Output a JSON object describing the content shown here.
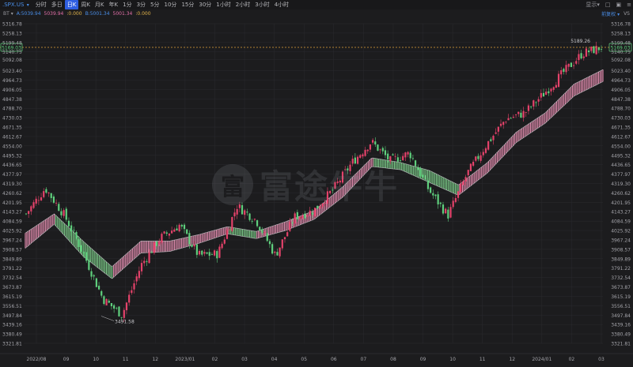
{
  "toolbar": {
    "symbol": ".SPX.US",
    "symbol_icon": "caret-down-icon",
    "tabs": [
      "分时",
      "多日",
      "日K",
      "周K",
      "月K",
      "年K",
      "1分",
      "3分",
      "5分",
      "10分",
      "15分",
      "30分",
      "1小时",
      "2小时",
      "3小时",
      "4小时"
    ],
    "active_tab": "日K",
    "display_label": "显示",
    "display_icon": "caret-down-icon",
    "icons": [
      "square-icon",
      "box-icon",
      "list-icon"
    ]
  },
  "indicators": {
    "name": "BT",
    "items": [
      {
        "text": "A:5039.94",
        "color": "#4a8ee8"
      },
      {
        "text": "5039.94",
        "color": "#e26fa8"
      },
      {
        "text": ":0.000",
        "color": "#e0b24a"
      },
      {
        "text": "B:5001.34",
        "color": "#4a8ee8"
      },
      {
        "text": "5001.34",
        "color": "#e26fa8"
      },
      {
        "text": ":0.000",
        "color": "#e0b24a"
      }
    ],
    "adjust_label": "前复权",
    "vs_label": "VS"
  },
  "colors": {
    "up": "#e4426a",
    "down": "#5fcf7d",
    "band_up": "#e78fb2",
    "band_down": "#7fd18c",
    "current_line": "#e0a23a",
    "grid": "#2b2b2f",
    "axis_text": "#a4a4aa"
  },
  "watermark": {
    "icon": "futu-logo-icon",
    "text": "富途牛牛"
  },
  "chart_data": {
    "type": "candlestick",
    "title": "",
    "y_ticks": [
      5316.78,
      5258.13,
      5199.48,
      5140.75,
      5092.08,
      5023.4,
      4964.73,
      4906.05,
      4847.38,
      4788.7,
      4730.03,
      4671.35,
      4612.67,
      4554.0,
      4495.32,
      4436.65,
      4377.97,
      4319.3,
      4260.62,
      4201.95,
      4143.27,
      4084.59,
      4025.92,
      3967.24,
      3908.57,
      3849.89,
      3791.22,
      3732.54,
      3673.87,
      3615.19,
      3556.51,
      3497.84,
      3439.16,
      3380.49,
      3321.81
    ],
    "x_labels": [
      "2022/08",
      "09",
      "10",
      "11",
      "12",
      "2023/01",
      "02",
      "03",
      "04",
      "05",
      "06",
      "07",
      "08",
      "09",
      "10",
      "11",
      "12",
      "2024/01",
      "02",
      "03"
    ],
    "ylim": [
      3321.81,
      5316.78
    ],
    "current_price": 5169.03,
    "current_price_label": "5169.03",
    "high_annotation": {
      "value": 5189.26,
      "label": "5189.26"
    },
    "low_annotation": {
      "value": 3491.58,
      "label": "3491.58"
    },
    "close_path": [
      {
        "x": "2022/08",
        "close": 4130
      },
      {
        "x": "2022/08 mid",
        "close": 4290
      },
      {
        "x": "09 start",
        "close": 4120
      },
      {
        "x": "09 mid",
        "close": 3880
      },
      {
        "x": "10 start",
        "close": 3600
      },
      {
        "x": "10 mid",
        "close": 3500
      },
      {
        "x": "11 start",
        "close": 3810
      },
      {
        "x": "11 mid",
        "close": 3980
      },
      {
        "x": "12 start",
        "close": 4060
      },
      {
        "x": "12 mid",
        "close": 3870
      },
      {
        "x": "2023/01 start",
        "close": 3880
      },
      {
        "x": "02 start",
        "close": 4180
      },
      {
        "x": "02 mid",
        "close": 4090
      },
      {
        "x": "03 mid",
        "close": 3870
      },
      {
        "x": "04 start",
        "close": 4110
      },
      {
        "x": "05 start",
        "close": 4150
      },
      {
        "x": "06 start",
        "close": 4280
      },
      {
        "x": "07 start",
        "close": 4450
      },
      {
        "x": "07 end",
        "close": 4580
      },
      {
        "x": "08 mid",
        "close": 4460
      },
      {
        "x": "09 start",
        "close": 4510
      },
      {
        "x": "10 start",
        "close": 4280
      },
      {
        "x": "10 end",
        "close": 4120
      },
      {
        "x": "11 start",
        "close": 4380
      },
      {
        "x": "11 end",
        "close": 4560
      },
      {
        "x": "12 mid",
        "close": 4720
      },
      {
        "x": "2024/01 start",
        "close": 4760
      },
      {
        "x": "2024/01 end",
        "close": 4880
      },
      {
        "x": "02 mid",
        "close": 5010
      },
      {
        "x": "03 start",
        "close": 5130
      },
      {
        "x": "03 end",
        "close": 5169
      }
    ],
    "band": [
      {
        "x": "2022/08",
        "upper": 4010,
        "lower": 3930
      },
      {
        "x": "09 start",
        "upper": 4130,
        "lower": 4080
      },
      {
        "x": "10 start",
        "upper": 3960,
        "lower": 3880
      },
      {
        "x": "11 start",
        "upper": 3800,
        "lower": 3740
      },
      {
        "x": "12 start",
        "upper": 3960,
        "lower": 3900
      },
      {
        "x": "2023/01 start",
        "upper": 3960,
        "lower": 3910
      },
      {
        "x": "02 start",
        "upper": 4000,
        "lower": 3960
      },
      {
        "x": "03 start",
        "upper": 4050,
        "lower": 4020
      },
      {
        "x": "04 start",
        "upper": 4020,
        "lower": 3990
      },
      {
        "x": "05 start",
        "upper": 4080,
        "lower": 4040
      },
      {
        "x": "06 start",
        "upper": 4150,
        "lower": 4110
      },
      {
        "x": "07 start",
        "upper": 4300,
        "lower": 4250
      },
      {
        "x": "08 start",
        "upper": 4480,
        "lower": 4440
      },
      {
        "x": "09 start",
        "upper": 4450,
        "lower": 4420
      },
      {
        "x": "10 start",
        "upper": 4400,
        "lower": 4340
      },
      {
        "x": "11 start",
        "upper": 4310,
        "lower": 4260
      },
      {
        "x": "12 start",
        "upper": 4450,
        "lower": 4400
      },
      {
        "x": "2024/01 start",
        "upper": 4640,
        "lower": 4590
      },
      {
        "x": "02 start",
        "upper": 4760,
        "lower": 4710
      },
      {
        "x": "03 start",
        "upper": 4940,
        "lower": 4880
      },
      {
        "x": "03 end",
        "upper": 5030,
        "lower": 4970
      }
    ]
  }
}
